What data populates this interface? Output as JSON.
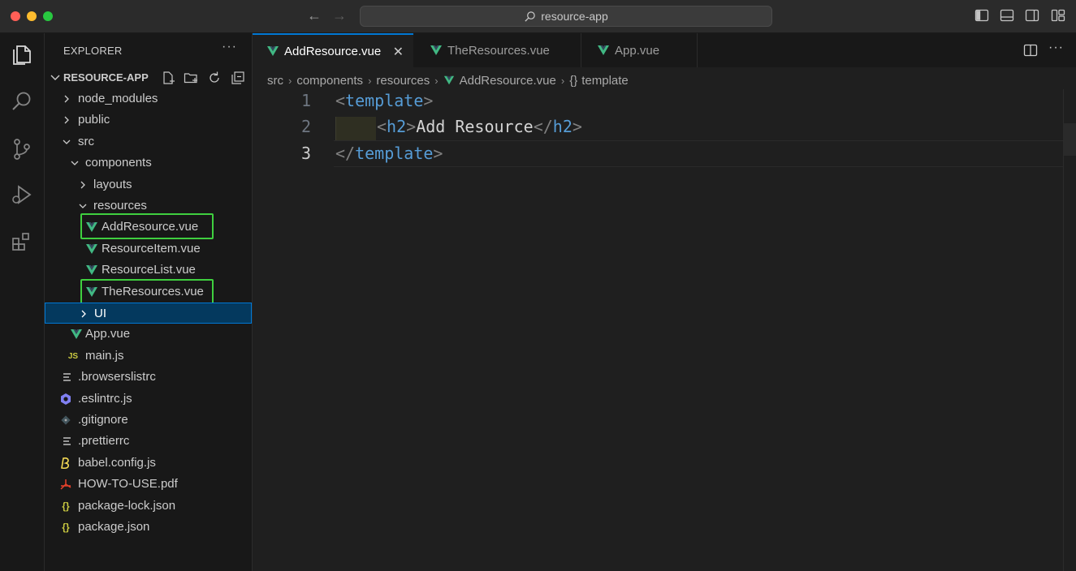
{
  "window": {
    "search_text": "resource-app"
  },
  "explorer": {
    "title": "EXPLORER",
    "more": "···",
    "project_name": "RESOURCE-APP",
    "items": [
      {
        "label": "node_modules",
        "kind": "folder",
        "expanded": false
      },
      {
        "label": "public",
        "kind": "folder",
        "expanded": false
      },
      {
        "label": "src",
        "kind": "folder",
        "expanded": true
      },
      {
        "label": "components",
        "kind": "folder",
        "expanded": true
      },
      {
        "label": "layouts",
        "kind": "folder",
        "expanded": false
      },
      {
        "label": "resources",
        "kind": "folder",
        "expanded": true
      },
      {
        "label": "AddResource.vue",
        "kind": "vue",
        "highlighted": true
      },
      {
        "label": "ResourceItem.vue",
        "kind": "vue"
      },
      {
        "label": "ResourceList.vue",
        "kind": "vue"
      },
      {
        "label": "TheResources.vue",
        "kind": "vue",
        "highlighted": true
      },
      {
        "label": "UI",
        "kind": "folder",
        "expanded": false,
        "selected": true
      },
      {
        "label": "App.vue",
        "kind": "vue"
      },
      {
        "label": "main.js",
        "kind": "js",
        "icon_text": "JS"
      },
      {
        "label": ".browserslistrc",
        "kind": "text"
      },
      {
        "label": ".eslintrc.js",
        "kind": "eslint"
      },
      {
        "label": ".gitignore",
        "kind": "git"
      },
      {
        "label": ".prettierrc",
        "kind": "text"
      },
      {
        "label": "babel.config.js",
        "kind": "babel"
      },
      {
        "label": "HOW-TO-USE.pdf",
        "kind": "pdf"
      },
      {
        "label": "package-lock.json",
        "kind": "json",
        "icon_text": "{}"
      },
      {
        "label": "package.json",
        "kind": "json",
        "icon_text": "{}"
      }
    ]
  },
  "tabs": [
    {
      "label": "AddResource.vue",
      "active": true,
      "close": "✕"
    },
    {
      "label": "TheResources.vue",
      "active": false
    },
    {
      "label": "App.vue",
      "active": false
    }
  ],
  "breadcrumb": {
    "parts": [
      "src",
      "components",
      "resources",
      "AddResource.vue",
      "template"
    ],
    "symbol_prefix": "{}"
  },
  "code": {
    "lines": [
      {
        "number": "1",
        "open": "<",
        "tag": "template",
        "close": ">"
      },
      {
        "number": "2",
        "open1": "<",
        "tag1": "h2",
        "close1": ">",
        "text": "Add Resource",
        "open2": "</",
        "tag2": "h2",
        "close2": ">"
      },
      {
        "number": "3",
        "open": "</",
        "tag": "template",
        "close": ">"
      }
    ],
    "active_line": 3
  },
  "colors": {
    "vue_green": "#41b883",
    "highlight_box": "#3fcf3f",
    "selection": "#04395e",
    "accent": "#0078d4",
    "tag_blue": "#569cd6"
  }
}
